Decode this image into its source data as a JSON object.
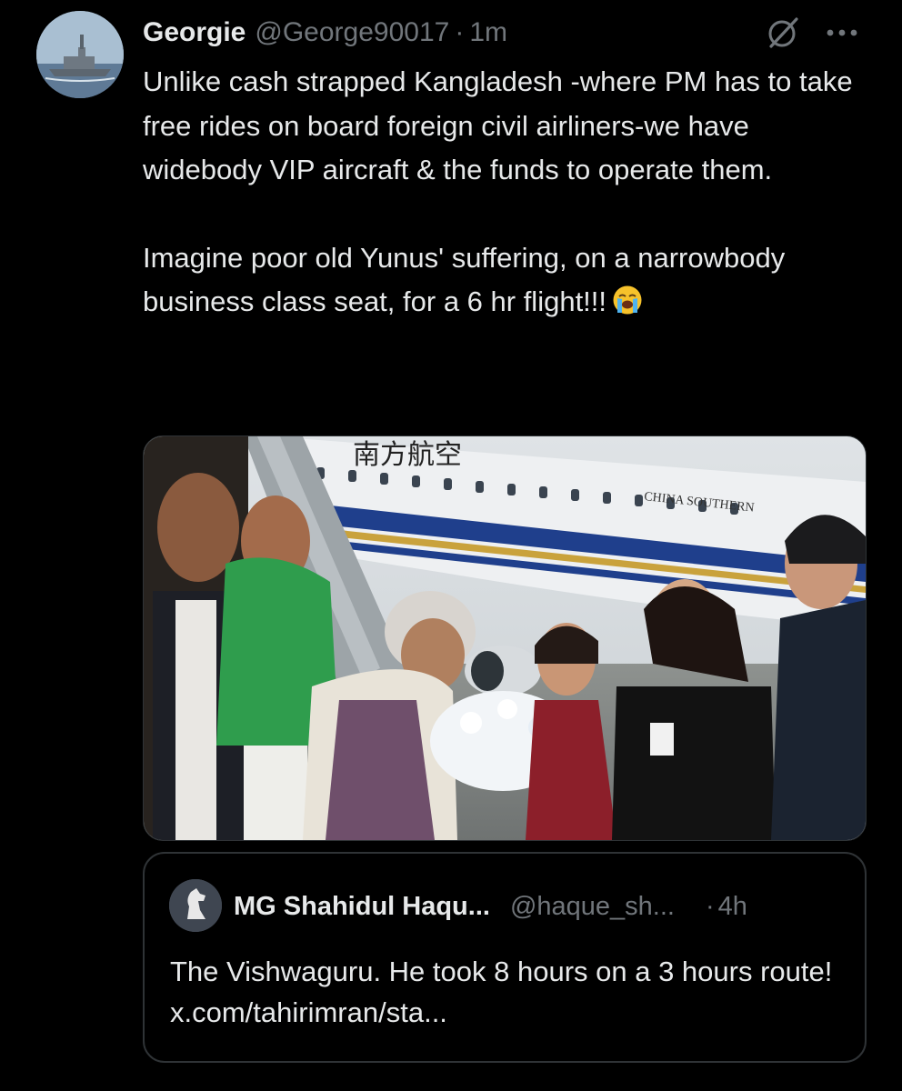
{
  "tweet": {
    "author_name": "Georgie",
    "author_handle": "@George90017",
    "separator": "·",
    "time": "1m",
    "paragraph1": "Unlike cash strapped Kangladesh -where PM has to take free rides on board foreign civil airliners-we have widebody VIP aircraft & the funds to operate them.",
    "paragraph2": "Imagine poor old Yunus' suffering, on a narrowbody business class seat, for a 6 hr flight!!!",
    "emoji": "loudly-crying-face-emoji",
    "icons": {
      "grok": "grok-slash-icon",
      "more": "more-options-icon"
    }
  },
  "photo": {
    "fuselage_text_cn": "南方航空",
    "fuselage_text_en": "CHINA SOUTHERN"
  },
  "quote": {
    "author_name": "MG Shahidul Haqu...",
    "author_handle": "@haque_sh...",
    "separator": "·",
    "time": "4h",
    "text": "The Vishwaguru. He took 8 hours on a 3 hours route! x.com/tahirimran/sta..."
  },
  "colors": {
    "background": "#000000",
    "text": "#e7e9ea",
    "secondary": "#71767b",
    "border": "#2f3336"
  }
}
